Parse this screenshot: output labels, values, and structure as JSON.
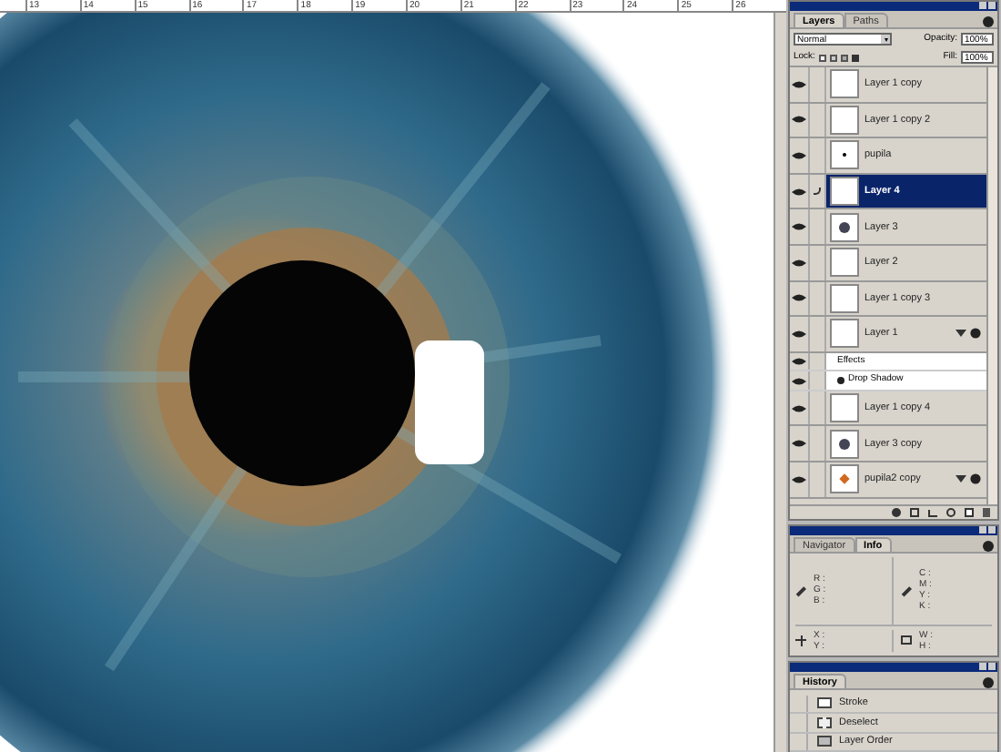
{
  "ruler": {
    "labels": [
      "13",
      "14",
      "15",
      "16",
      "17",
      "18",
      "19",
      "20",
      "21",
      "22",
      "23",
      "24",
      "25",
      "26"
    ]
  },
  "layers_panel": {
    "tabs": [
      {
        "label": "Layers",
        "selected": true
      },
      {
        "label": "Paths",
        "selected": false
      }
    ],
    "blend_mode": "Normal",
    "opacity_label": "Opacity:",
    "opacity": "100%",
    "lock_label": "Lock:",
    "fill_label": "Fill:",
    "fill": "100%",
    "layers": [
      {
        "kind": "layer",
        "name": "Layer 1 copy",
        "visible": true,
        "selected": false,
        "thumbnail": {
          "kind": "empty"
        },
        "effects": false,
        "brush": false
      },
      {
        "kind": "layer",
        "name": "Layer 1 copy 2",
        "visible": true,
        "selected": false,
        "thumbnail": {
          "kind": "empty"
        },
        "effects": false,
        "brush": false
      },
      {
        "kind": "layer",
        "name": "pupila",
        "visible": true,
        "selected": false,
        "thumbnail": {
          "kind": "dot"
        },
        "effects": false,
        "brush": false
      },
      {
        "kind": "layer",
        "name": "Layer 4",
        "visible": true,
        "selected": true,
        "thumbnail": {
          "kind": "empty"
        },
        "effects": false,
        "brush": true
      },
      {
        "kind": "layer",
        "name": "Layer 3",
        "visible": true,
        "selected": false,
        "thumbnail": {
          "kind": "blob"
        },
        "effects": false,
        "brush": false
      },
      {
        "kind": "layer",
        "name": "Layer 2",
        "visible": true,
        "selected": false,
        "thumbnail": {
          "kind": "empty"
        },
        "effects": false,
        "brush": false
      },
      {
        "kind": "layer",
        "name": "Layer 1 copy 3",
        "visible": true,
        "selected": false,
        "thumbnail": {
          "kind": "empty"
        },
        "effects": false,
        "brush": false
      },
      {
        "kind": "layer",
        "name": "Layer 1",
        "visible": true,
        "selected": false,
        "thumbnail": {
          "kind": "empty"
        },
        "effects": true,
        "brush": false
      },
      {
        "kind": "effects_header",
        "name": "Effects",
        "visible": true
      },
      {
        "kind": "effect",
        "name": "Drop Shadow",
        "visible": true
      },
      {
        "kind": "layer",
        "name": "Layer 1 copy 4",
        "visible": true,
        "selected": false,
        "thumbnail": {
          "kind": "empty"
        },
        "effects": false,
        "brush": false
      },
      {
        "kind": "layer",
        "name": "Layer 3 copy",
        "visible": true,
        "selected": false,
        "thumbnail": {
          "kind": "blob"
        },
        "effects": false,
        "brush": false
      },
      {
        "kind": "layer",
        "name": "pupila2 copy",
        "visible": true,
        "selected": false,
        "thumbnail": {
          "kind": "star"
        },
        "effects": true,
        "brush": false
      }
    ]
  },
  "info_panel": {
    "tabs": [
      {
        "label": "Navigator",
        "selected": false
      },
      {
        "label": "Info",
        "selected": true
      }
    ],
    "groups": [
      {
        "kind": "eyedropper",
        "labels": [
          "R :",
          "G :",
          "B :"
        ]
      },
      {
        "kind": "eyedropper",
        "labels": [
          "C :",
          "M :",
          "Y :",
          "K :"
        ]
      },
      {
        "kind": "crosshair",
        "labels": [
          "X :",
          "Y :"
        ]
      },
      {
        "kind": "marquee",
        "labels": [
          "W :",
          "H :"
        ]
      }
    ]
  },
  "history_panel": {
    "tabs": [
      {
        "label": "History",
        "selected": true
      }
    ],
    "items": [
      {
        "name": "Stroke",
        "kind": "stroke"
      },
      {
        "name": "Deselect",
        "kind": "deselect"
      },
      {
        "name": "Layer Order",
        "kind": "order"
      }
    ]
  }
}
